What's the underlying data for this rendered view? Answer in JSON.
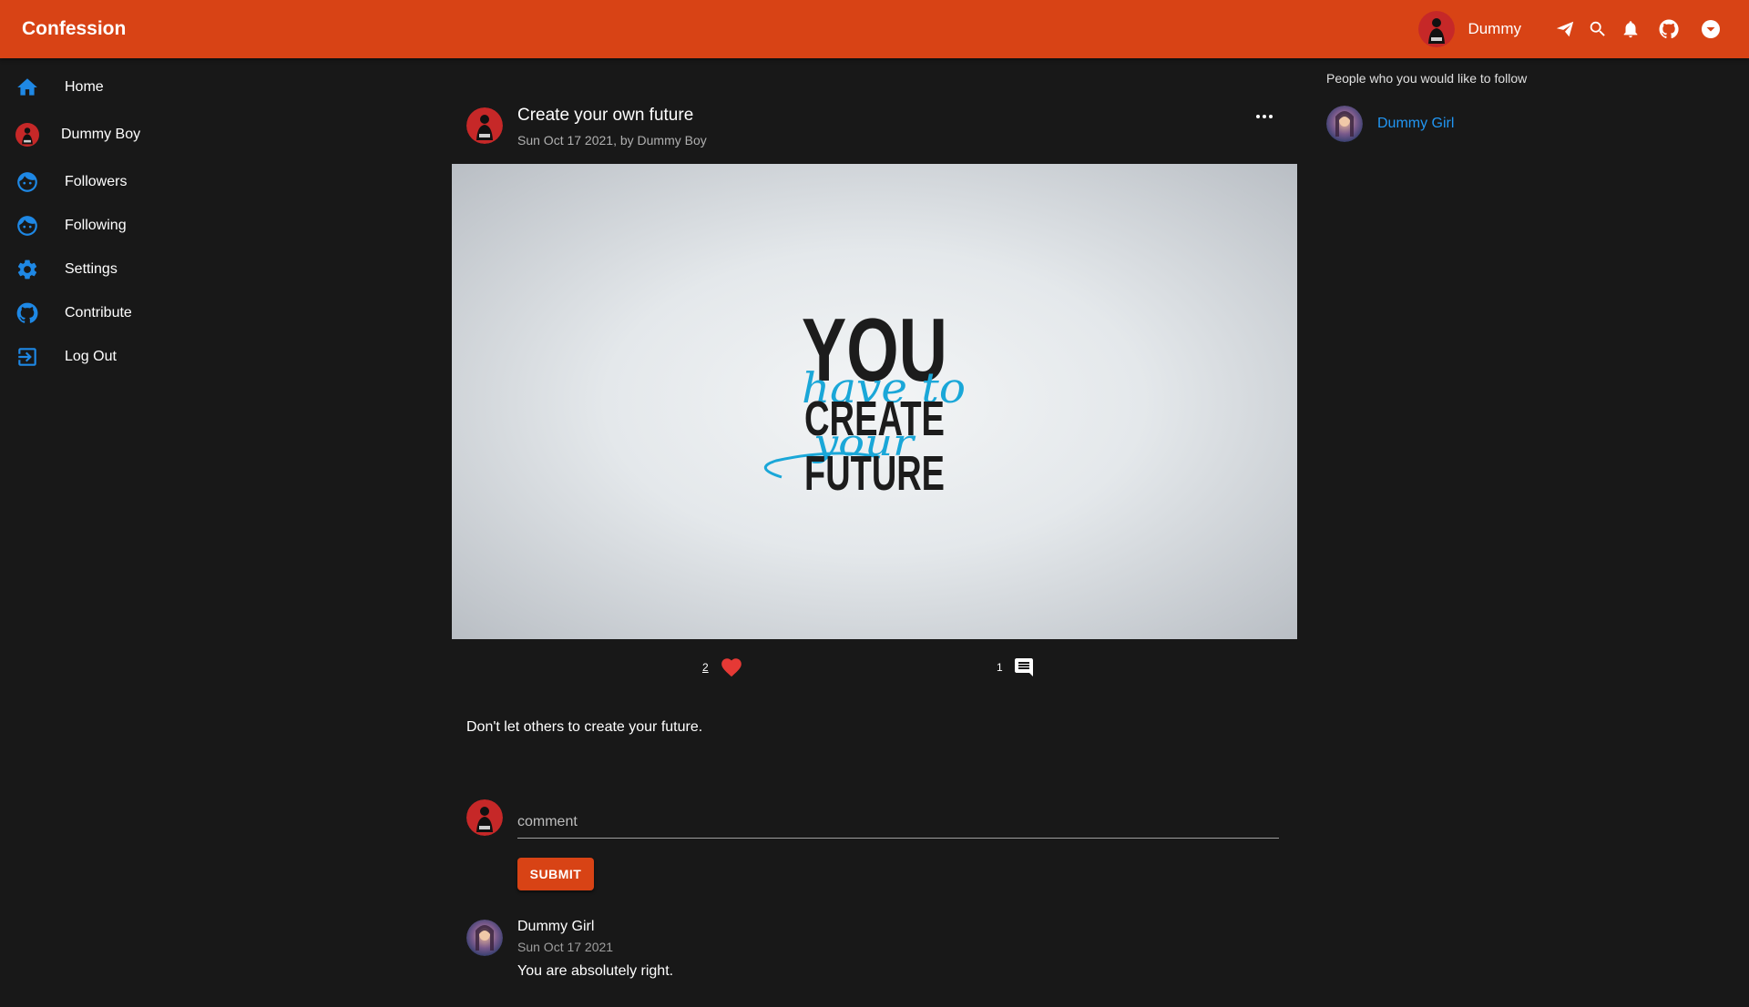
{
  "app": {
    "title": "Confession"
  },
  "header": {
    "user_name": "Dummy"
  },
  "sidebar": {
    "items": [
      {
        "label": "Home",
        "icon": "home-icon"
      },
      {
        "label": "Dummy Boy",
        "icon": "avatar"
      },
      {
        "label": "Followers",
        "icon": "face-icon"
      },
      {
        "label": "Following",
        "icon": "face-icon"
      },
      {
        "label": "Settings",
        "icon": "gear-icon"
      },
      {
        "label": "Contribute",
        "icon": "github-icon"
      },
      {
        "label": "Log Out",
        "icon": "logout-icon"
      }
    ]
  },
  "post": {
    "title": "Create your own future",
    "subtitle": "Sun Oct 17 2021, by Dummy Boy",
    "image_text": {
      "line1": "YOU",
      "script1": "have to",
      "line2": "CREATE",
      "script2": "your",
      "line3": "FUTURE"
    },
    "like_count": "2",
    "comment_count": "1",
    "body": "Don't let others to create your future."
  },
  "comment_form": {
    "placeholder": "comment",
    "submit_label": "SUBMIT"
  },
  "comments": [
    {
      "author": "Dummy Girl",
      "date": "Sun Oct 17 2021",
      "text": "You are absolutely right."
    }
  ],
  "suggestions": {
    "title": "People who you would like to follow",
    "users": [
      {
        "name": "Dummy Girl"
      }
    ]
  },
  "colors": {
    "appbar": "#d84315",
    "background": "#181818",
    "nav_icon": "#1e88e5",
    "link": "#2196f3",
    "like": "#e53935"
  }
}
